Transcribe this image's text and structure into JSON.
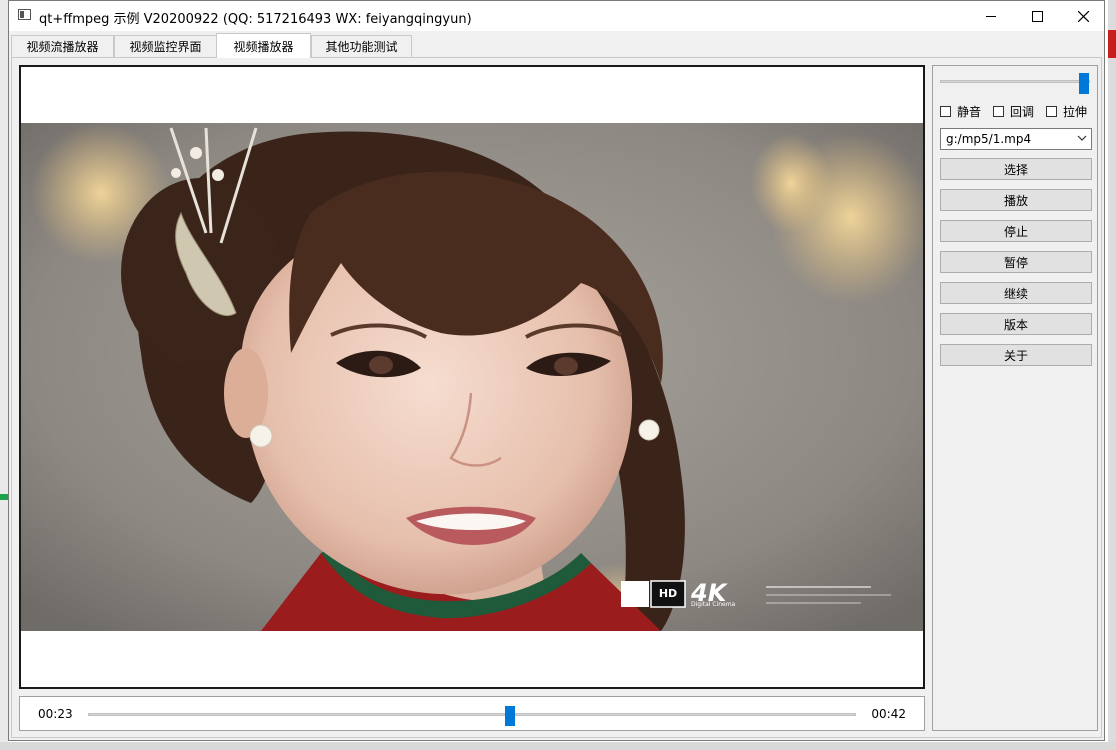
{
  "window": {
    "title": "qt+ffmpeg 示例 V20200922 (QQ: 517216493 WX: feiyangqingyun)",
    "controls": [
      "minimize-icon",
      "maximize-icon",
      "close-icon"
    ]
  },
  "tabs": [
    {
      "label": "视频流播放器",
      "active": false
    },
    {
      "label": "视频监控界面",
      "active": false
    },
    {
      "label": "视频播放器",
      "active": true
    },
    {
      "label": "其他功能测试",
      "active": false
    }
  ],
  "player": {
    "current_time": "00:23",
    "total_time": "00:42",
    "progress": 0.55,
    "volume": 1.0,
    "overlay": {
      "hd_label": "HD",
      "brand": "4K",
      "brand_sub": "Digital Cinema"
    }
  },
  "side": {
    "mute_label": "静音",
    "callback_label": "回调",
    "stretch_label": "拉伸",
    "mute_checked": false,
    "callback_checked": false,
    "stretch_checked": false,
    "file_path": "g:/mp5/1.mp4",
    "buttons": [
      "选择",
      "播放",
      "停止",
      "暂停",
      "继续",
      "版本",
      "关于"
    ]
  },
  "colors": {
    "accent": "#0078d7",
    "window_bg": "#f0f0f0"
  }
}
